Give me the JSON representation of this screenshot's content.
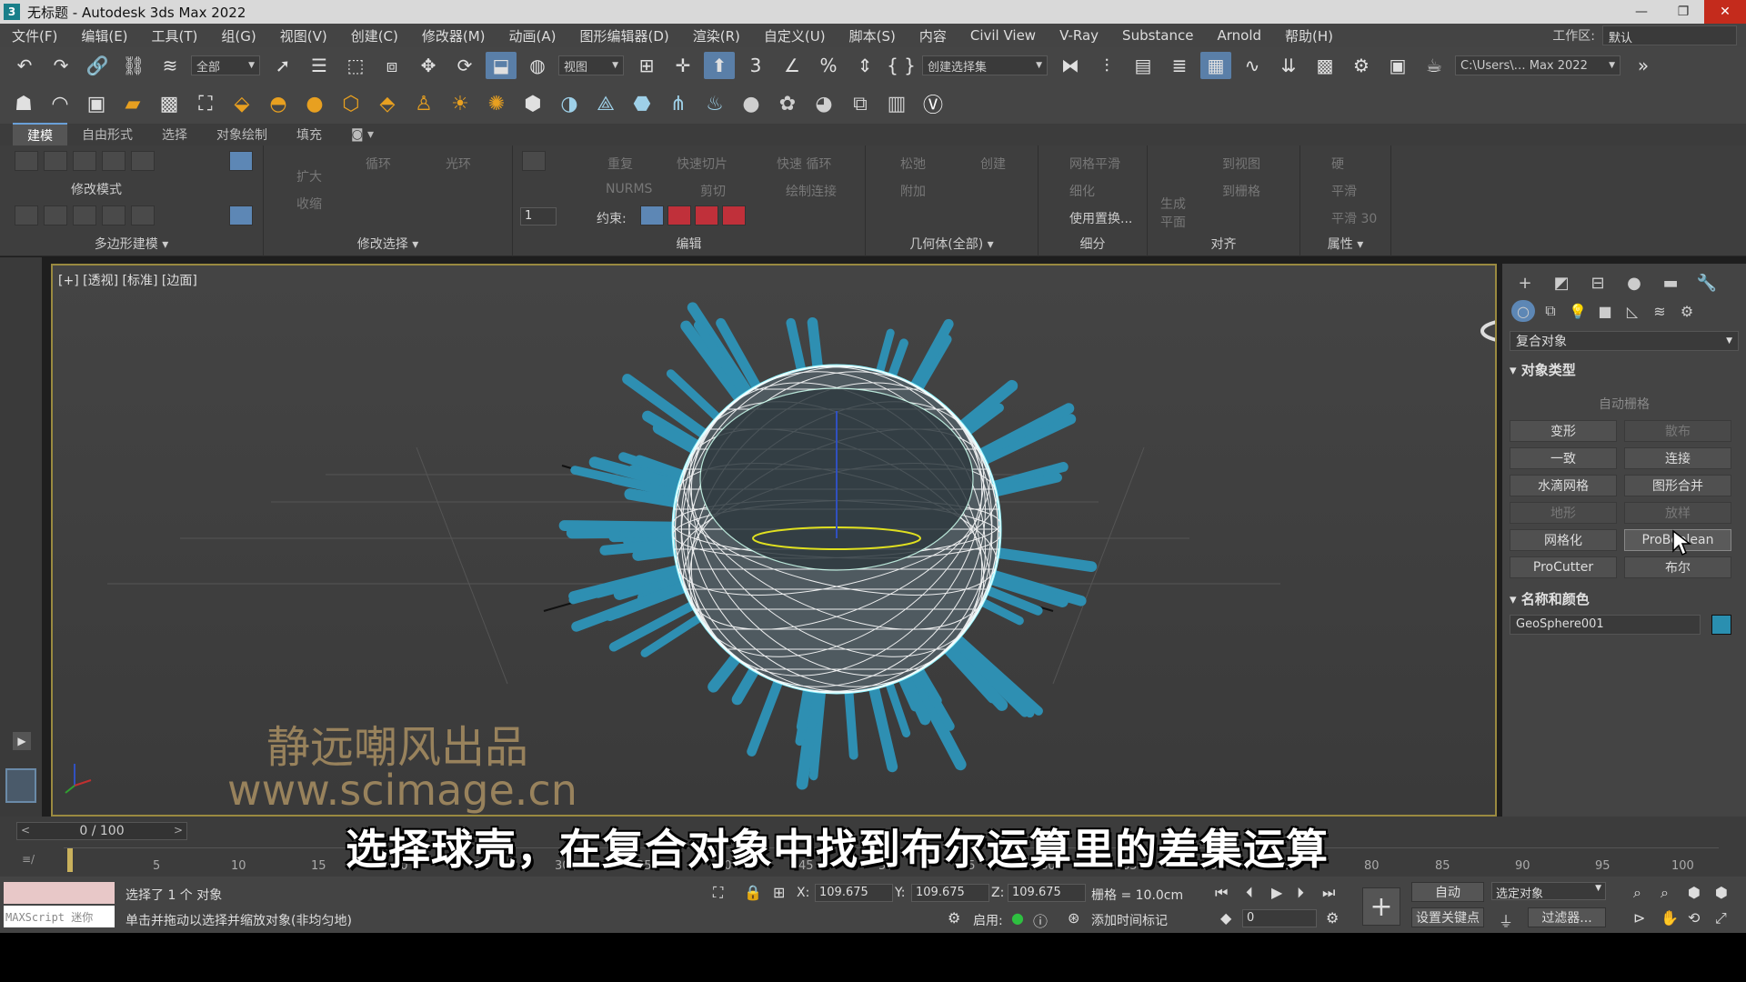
{
  "window": {
    "title": "无标题 - Autodesk 3ds Max 2022",
    "app_icon": "3"
  },
  "menu": {
    "items": [
      "文件(F)",
      "编辑(E)",
      "工具(T)",
      "组(G)",
      "视图(V)",
      "创建(C)",
      "修改器(M)",
      "动画(A)",
      "图形编辑器(D)",
      "渲染(R)",
      "自定义(U)",
      "脚本(S)",
      "内容",
      "Civil View",
      "V-Ray",
      "Substance",
      "Arnold",
      "帮助(H)"
    ],
    "workspace_label": "工作区:",
    "workspace_value": "默认"
  },
  "toolbar": {
    "selection_filter": "全部",
    "ref_coord": "视图",
    "named_selection": "创建选择集",
    "project_path": "C:\\Users\\… Max 2022"
  },
  "ribbon": {
    "tabs": [
      "建模",
      "自由形式",
      "选择",
      "对象绘制",
      "填充"
    ],
    "active_tab": 0,
    "modify_mode": "修改模式",
    "groups": {
      "poly_modeling": "多边形建模",
      "modify_selection": "修改选择",
      "edit": "编辑",
      "geometry_all": "几何体(全部)",
      "subdivision": "细分",
      "align": "对齐",
      "properties": "属性"
    },
    "labels": {
      "grow": "扩大",
      "shrink": "收缩",
      "loop": "循环",
      "ring": "光环",
      "repeat": "重复",
      "quickslice": "快速切片",
      "quickloop": "快速 循环",
      "nurms": "NURMS",
      "cut": "剪切",
      "paintconnect": "绘制连接",
      "constraints": "约束:",
      "relax": "松弛",
      "create": "创建",
      "attach": "附加",
      "meshsmooth": "网格平滑",
      "tessellate": "细化",
      "usedisplace": "使用置换...",
      "makeplanar": "生成平面",
      "toview": "到视图",
      "togrid": "到栅格",
      "hard": "硬",
      "smooth": "平滑",
      "smooth30": "平滑 30",
      "num_value": "1"
    }
  },
  "viewport": {
    "label": "[+] [透视] [标准] [边面]",
    "watermark_line1": "静远嘲风出品",
    "watermark_line2": "www.scimage.cn",
    "colors": {
      "wire": "#ffffff",
      "cylinders": "#2e8fb2",
      "shell_outline": "#7ff0ff",
      "frame": "#9a8a40"
    }
  },
  "command_panel": {
    "category": "复合对象",
    "object_type_title": "对象类型",
    "autogrid": "自动栅格",
    "buttons": [
      {
        "label": "变形",
        "enabled": true
      },
      {
        "label": "散布",
        "enabled": false
      },
      {
        "label": "一致",
        "enabled": true
      },
      {
        "label": "连接",
        "enabled": true
      },
      {
        "label": "水滴网格",
        "enabled": true
      },
      {
        "label": "图形合并",
        "enabled": true
      },
      {
        "label": "地形",
        "enabled": false
      },
      {
        "label": "放样",
        "enabled": false
      },
      {
        "label": "网格化",
        "enabled": true
      },
      {
        "label": "ProBoolean",
        "enabled": true
      },
      {
        "label": "ProCutter",
        "enabled": true
      },
      {
        "label": "布尔",
        "enabled": true
      }
    ],
    "name_color_title": "名称和颜色",
    "object_name": "GeoSphere001",
    "object_color": "#2a8fb0"
  },
  "timeline": {
    "frame_display": "0 / 100",
    "ticks": [
      "5",
      "10",
      "15",
      "20",
      "25",
      "30",
      "35",
      "40",
      "45",
      "50",
      "55",
      "60",
      "65",
      "70",
      "75",
      "80",
      "85",
      "90",
      "95",
      "100"
    ]
  },
  "subtitle": "选择球壳，在复合对象中找到布尔运算里的差集运算",
  "status": {
    "selection": "选择了 1 个 对象",
    "hint": "单击并拖动以选择并缩放对象(非均匀地)",
    "maxscript": "MAXScript 迷你",
    "x_label": "X:",
    "x": "109.675",
    "y_label": "Y:",
    "y": "109.675",
    "z_label": "Z:",
    "z": "109.675",
    "grid": "栅格 = 10.0cm",
    "enabled_label": "启用:",
    "add_time_tag": "添加时间标记",
    "auto_key": "自动",
    "set_key": "设置关键点",
    "selected_object": "选定对象",
    "filters": "过滤器...",
    "frame_field": "0"
  }
}
